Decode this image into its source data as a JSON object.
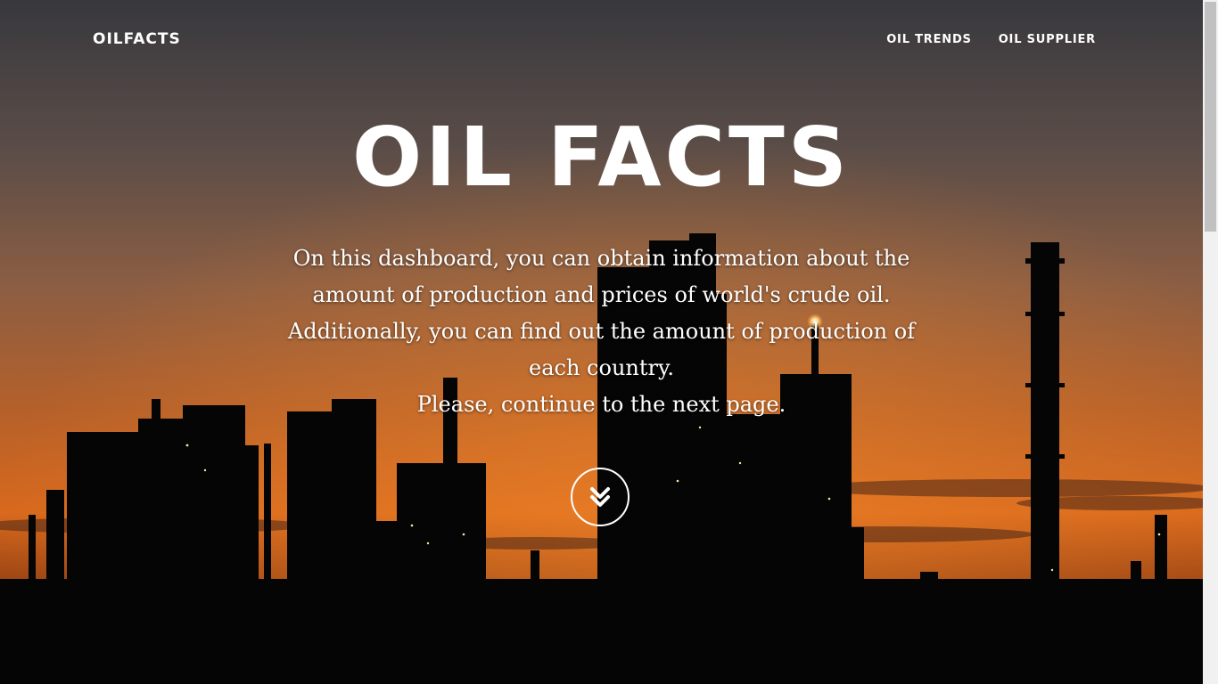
{
  "nav": {
    "brand": "OILFACTS",
    "links": [
      {
        "label": "OIL TRENDS"
      },
      {
        "label": "OIL SUPPLIER"
      }
    ]
  },
  "hero": {
    "title": "OIL FACTS",
    "description": "On this dashboard, you can obtain information about the amount of production and prices of world's crude oil. Additionally, you can find out the amount of production of each country.",
    "call_to_action": "Please, continue to the next page."
  },
  "icons": {
    "scroll_down": "chevron-double-down-icon"
  },
  "colors": {
    "sky_top": "#3b3a3f",
    "sky_mid": "#8a5f45",
    "sky_glow": "#e1701c",
    "silhouette": "#050505",
    "text": "#ffffff"
  }
}
